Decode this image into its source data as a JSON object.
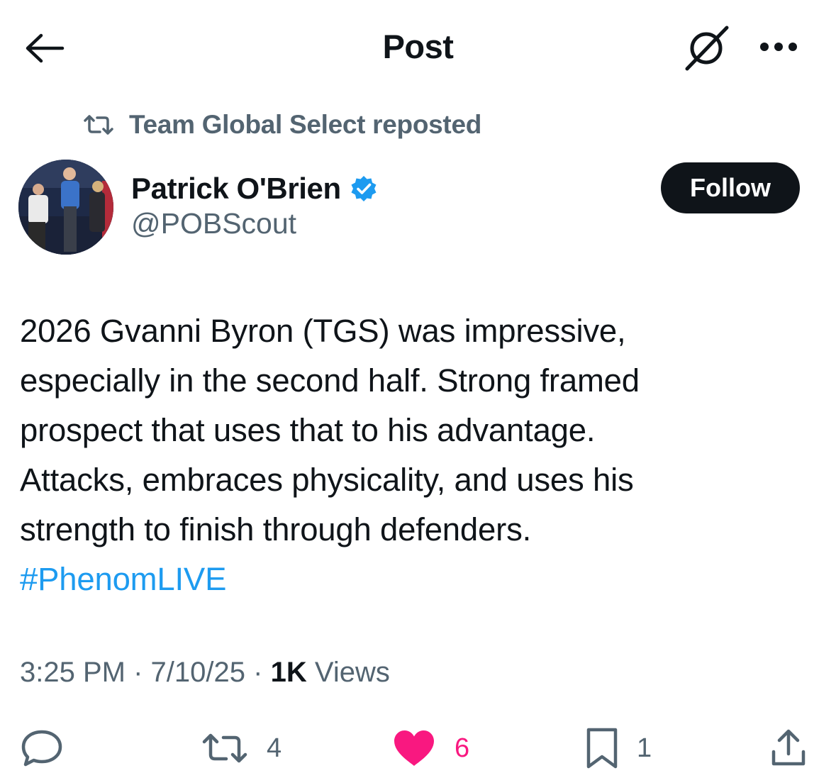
{
  "header": {
    "title": "Post"
  },
  "repost": {
    "text": "Team Global Select reposted"
  },
  "author": {
    "name": "Patrick O'Brien",
    "handle": "@POBScout",
    "verified": true
  },
  "follow_label": "Follow",
  "post": {
    "lines": [
      "2026 Gvanni Byron (TGS) was impressive,",
      "especially in the second half. Strong framed",
      "prospect that uses that to his advantage.",
      "Attacks, embraces physicality, and uses his",
      "strength to finish through defenders."
    ],
    "hashtag": "#PhenomLIVE"
  },
  "meta": {
    "time": "3:25 PM",
    "sep1": "·",
    "date": "7/10/25",
    "sep2": "·",
    "views_count": "1K",
    "views_label": "Views"
  },
  "actions": {
    "reply": {
      "icon": "reply-icon"
    },
    "repost": {
      "icon": "repost-icon",
      "count": "4"
    },
    "like": {
      "icon": "heart-icon",
      "count": "6",
      "liked": true
    },
    "bookmark": {
      "icon": "bookmark-icon",
      "count": "1"
    },
    "share": {
      "icon": "share-icon"
    }
  },
  "colors": {
    "text": "#0f1419",
    "secondary": "#536471",
    "accent": "#1d9bf0",
    "like": "#f91880",
    "verified": "#1d9bf0"
  }
}
